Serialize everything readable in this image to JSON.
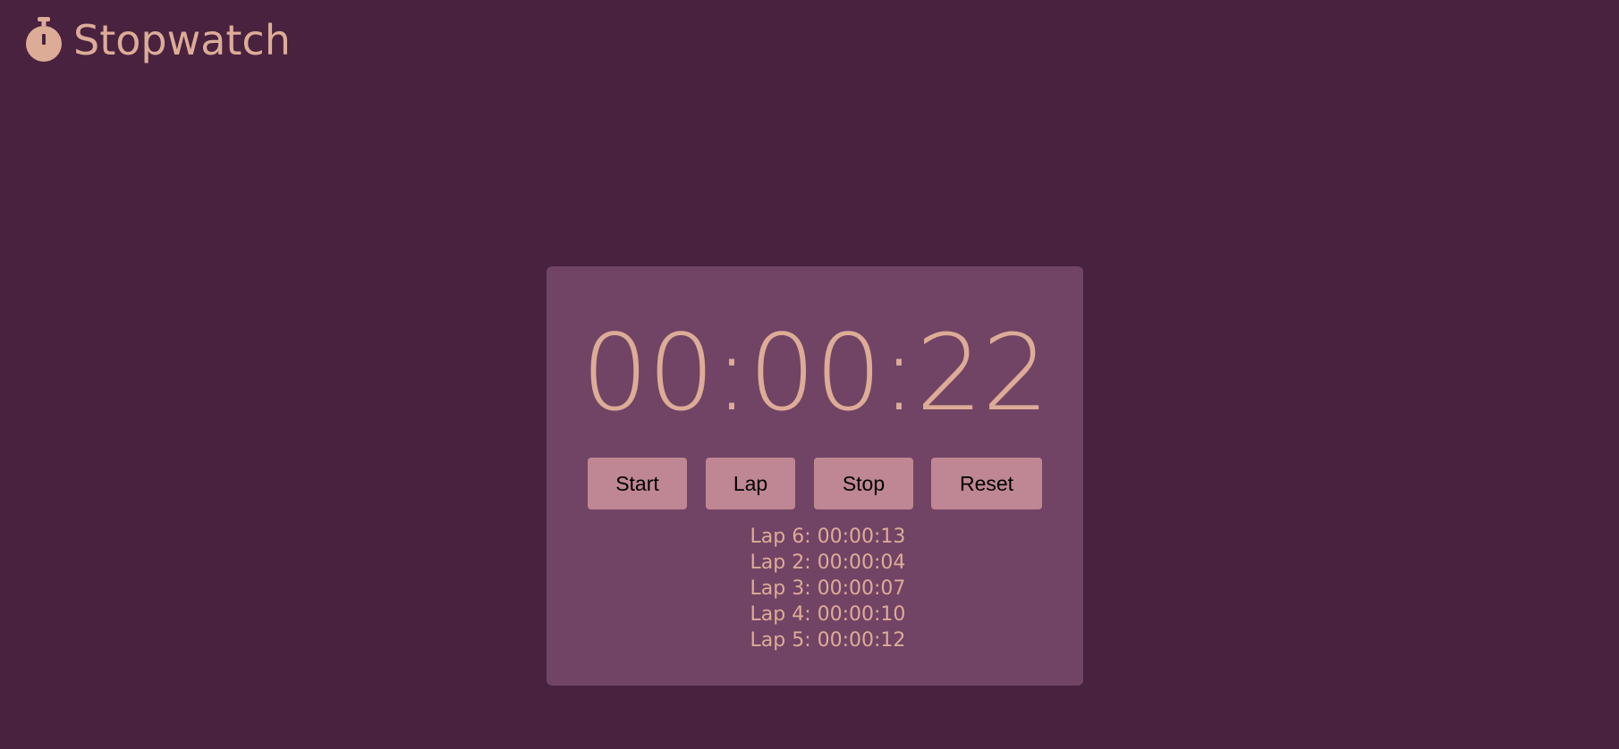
{
  "app": {
    "title": "Stopwatch",
    "icon": "stopwatch-icon"
  },
  "colors": {
    "background": "#48223f",
    "card": "#714465",
    "accent": "#ddac97",
    "button": "#bf8793",
    "button_text": "#000000"
  },
  "timer": {
    "display": "00:00:22"
  },
  "controls": {
    "start_label": "Start",
    "lap_label": "Lap",
    "stop_label": "Stop",
    "reset_label": "Reset"
  },
  "laps": [
    "Lap 6: 00:00:13",
    "Lap 2: 00:00:04",
    "Lap 3: 00:00:07",
    "Lap 4: 00:00:10",
    "Lap 5: 00:00:12"
  ]
}
